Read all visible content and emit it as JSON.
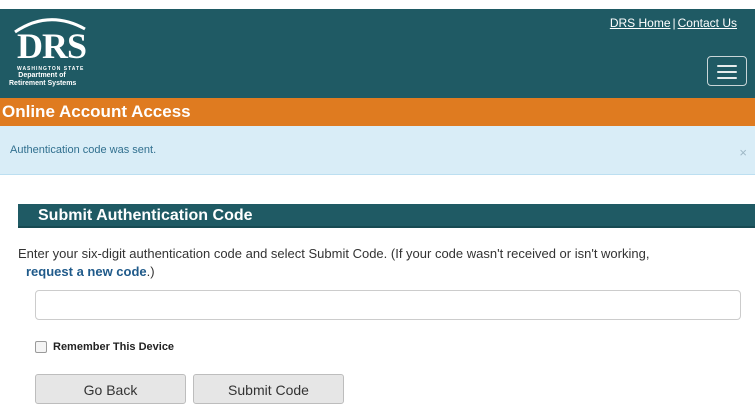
{
  "header": {
    "logo": {
      "wordmark": "DRS",
      "state_line": "WASHINGTON STATE",
      "dept_line1": "Department of",
      "dept_line2": "Retirement Systems"
    },
    "links": {
      "home": "DRS Home",
      "separator": "|",
      "contact": "Contact Us"
    },
    "menu_icon": "hamburger-menu-icon"
  },
  "title_bar": {
    "title": "Online Account Access"
  },
  "alert": {
    "message": "Authentication code was sent.",
    "close": "×"
  },
  "section": {
    "heading": "Submit Authentication Code",
    "instructions_part1": "Enter your six-digit authentication code and select Submit Code. (If your code wasn't received or isn't working,",
    "link_text": "request a new code",
    "instructions_part2": ".)"
  },
  "form": {
    "code_value": "",
    "code_placeholder": "",
    "remember_label": "Remember This Device",
    "remember_checked": false,
    "back_label": "Go Back",
    "submit_label": "Submit Code"
  },
  "colors": {
    "header_teal": "#1f5a64",
    "title_orange": "#df7b20",
    "alert_bg": "#d9edf7",
    "alert_text": "#31708f",
    "link_blue": "#1f5a8a"
  }
}
